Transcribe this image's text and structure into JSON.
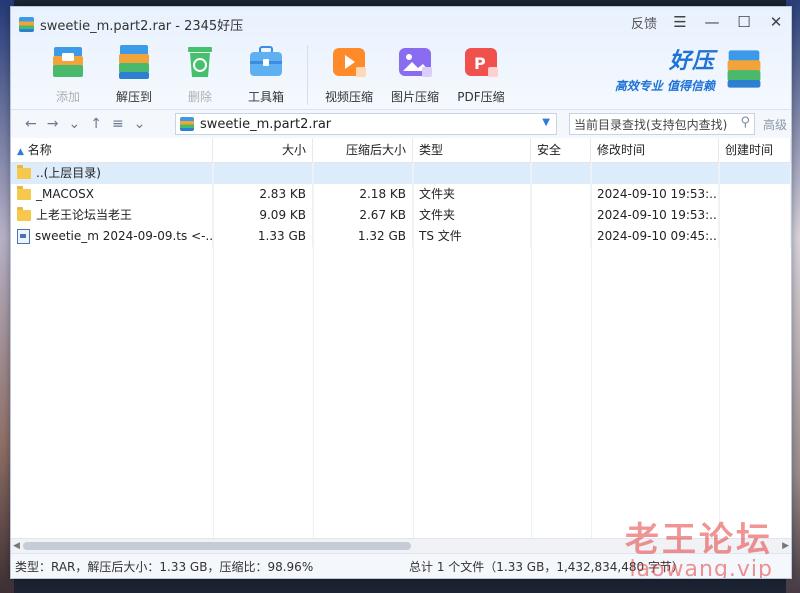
{
  "window": {
    "title": "sweetie_m.part2.rar - 2345好压",
    "feedback": "反馈"
  },
  "toolbar": {
    "items": [
      {
        "label": "添加",
        "icon": "add-box-icon",
        "enabled": false
      },
      {
        "label": "解压到",
        "icon": "extract-box-icon",
        "enabled": true
      },
      {
        "label": "删除",
        "icon": "recycle-bin-icon",
        "enabled": false
      },
      {
        "label": "工具箱",
        "icon": "toolbox-icon",
        "enabled": true
      },
      {
        "label": "视频压缩",
        "icon": "video-compress-icon",
        "enabled": true
      },
      {
        "label": "图片压缩",
        "icon": "image-compress-icon",
        "enabled": true
      },
      {
        "label": "PDF压缩",
        "icon": "pdf-compress-icon",
        "enabled": true
      }
    ]
  },
  "brand": {
    "name": "好压",
    "slogan": "高效专业  值得信赖"
  },
  "address": {
    "path": "sweetie_m.part2.rar",
    "search_placeholder": "当前目录查找(支持包内查找)",
    "advanced": "高级"
  },
  "columns": [
    "名称",
    "大小",
    "压缩后大小",
    "类型",
    "安全",
    "修改时间",
    "创建时间"
  ],
  "rows": [
    {
      "name": "..(上层目录)",
      "size": "",
      "packed": "",
      "type": "",
      "security": "",
      "modified": "",
      "created": "",
      "icon": "folder",
      "selected": true
    },
    {
      "name": "_MACOSX",
      "size": "2.83 KB",
      "packed": "2.18 KB",
      "type": "文件夹",
      "security": "",
      "modified": "2024-09-10 19:53:...",
      "created": "",
      "icon": "folder",
      "selected": false
    },
    {
      "name": "上老王论坛当老王",
      "size": "9.09 KB",
      "packed": "2.67 KB",
      "type": "文件夹",
      "security": "",
      "modified": "2024-09-10 19:53:...",
      "created": "",
      "icon": "folder",
      "selected": false
    },
    {
      "name": "sweetie_m  2024-09-09.ts  <-...",
      "size": "1.33 GB",
      "packed": "1.32 GB",
      "type": "TS 文件",
      "security": "",
      "modified": "2024-09-10 09:45:...",
      "created": "",
      "icon": "file",
      "selected": false
    }
  ],
  "status": {
    "left": "类型：RAR，解压后大小：1.33 GB，压缩比：98.96%",
    "right": "总计 1 个文件（1.33 GB，1,432,834,480 字节）"
  },
  "watermark": {
    "line1": "老王论坛",
    "line2": "laowang.vip"
  }
}
